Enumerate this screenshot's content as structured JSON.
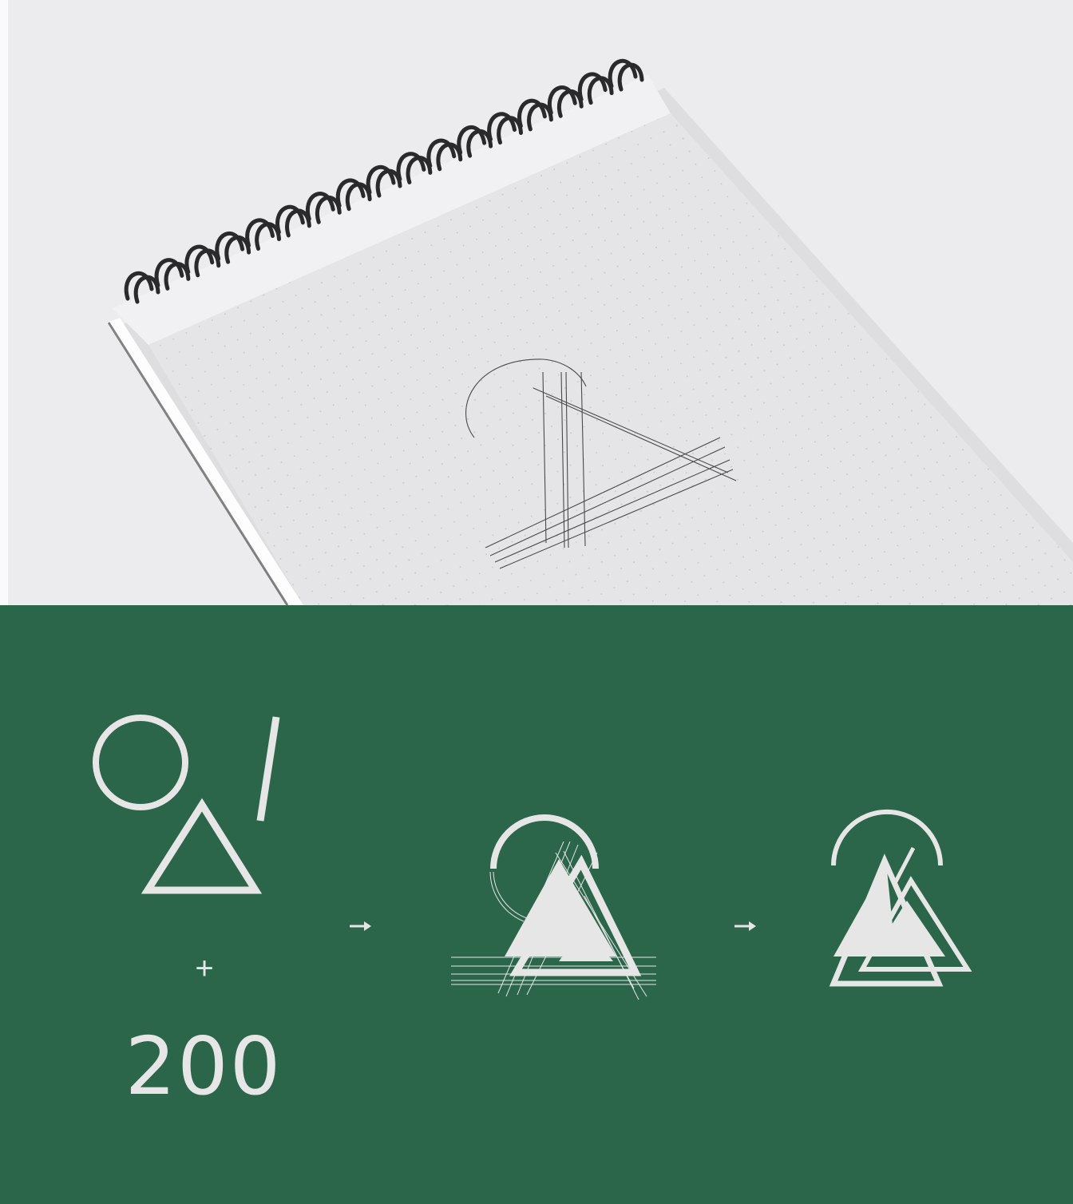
{
  "colors": {
    "photo_background": "#ececee",
    "notebook_paper": "#e5e5e7",
    "spiral_wire": "#2a2a2c",
    "sketch_line": "#4a4a4a",
    "panel_background": "#2b654a",
    "mark_color": "#e6e6e6"
  },
  "photo": {
    "subject": "spiral-notebook",
    "sketch": "pencil-logo-sketch"
  },
  "panel": {
    "plus_symbol": "+",
    "number_text": "200",
    "arrows": [
      "arrow-right-icon",
      "arrow-right-icon"
    ],
    "shapes": [
      "circle-icon",
      "slash-icon",
      "triangle-icon"
    ],
    "steps": [
      "construction-logo",
      "final-logo"
    ]
  }
}
